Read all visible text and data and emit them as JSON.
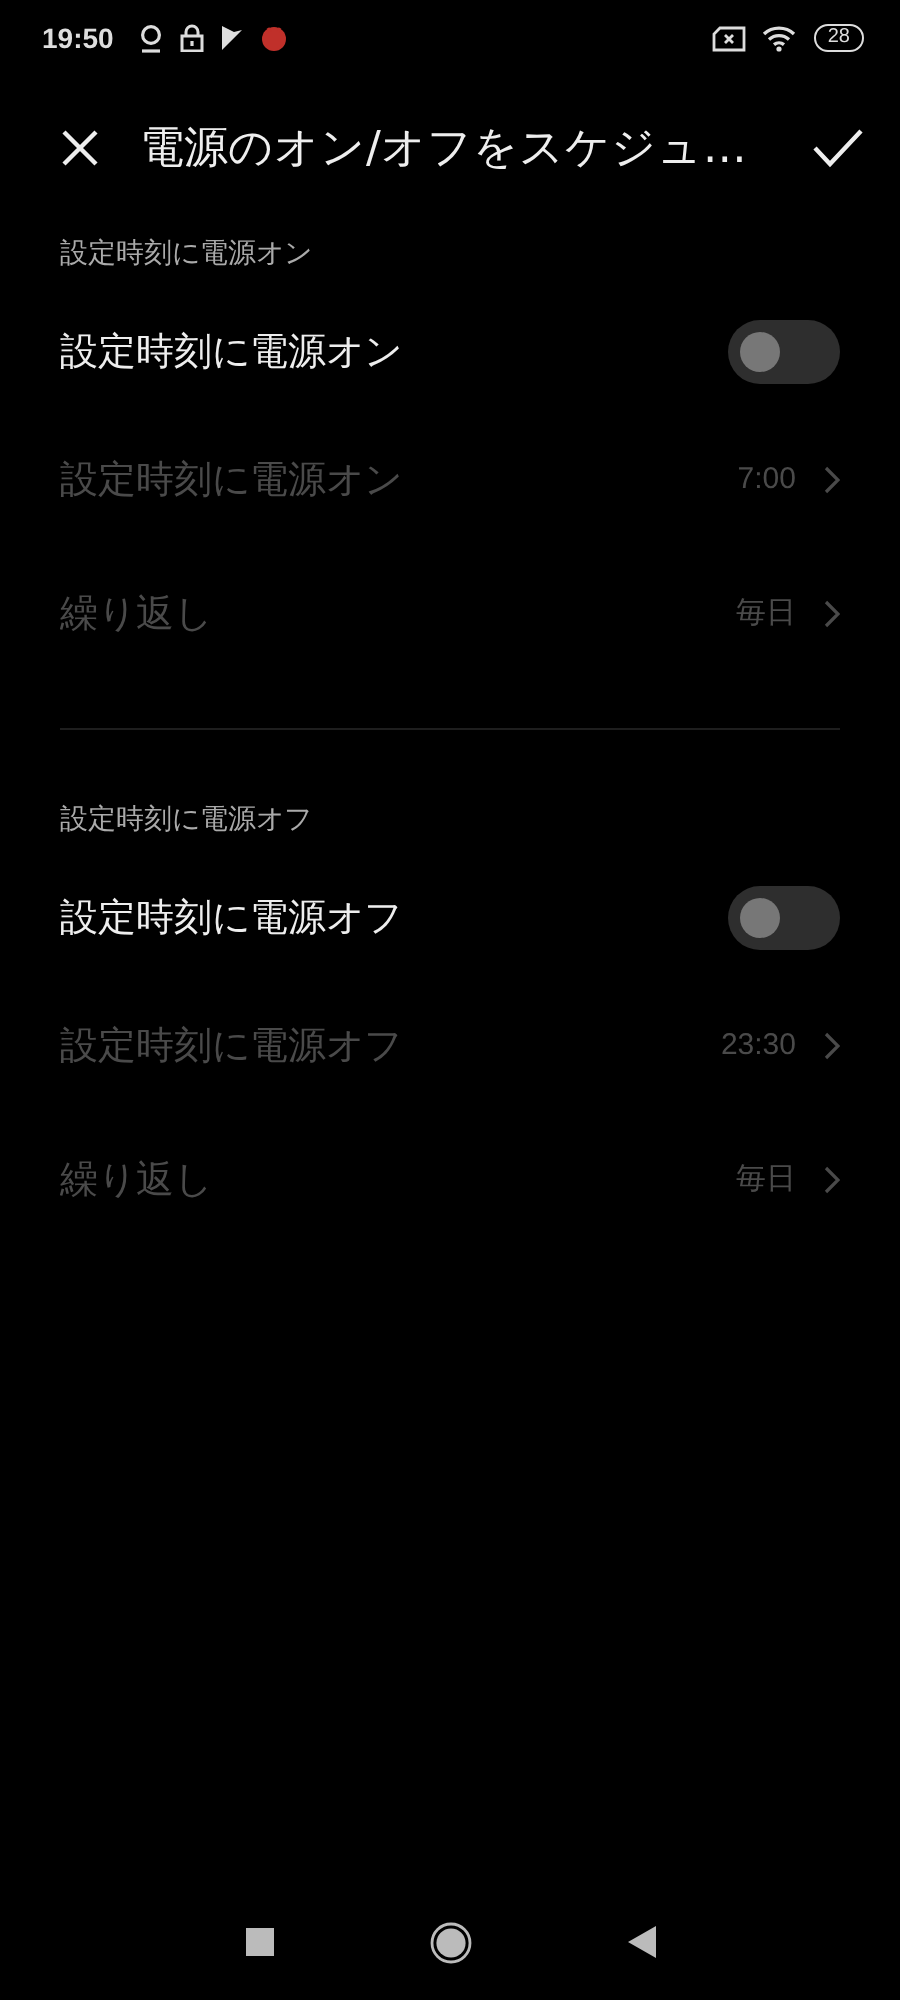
{
  "status_bar": {
    "time": "19:50",
    "battery": "28"
  },
  "header": {
    "title": "電源のオン/オフをスケジュ…"
  },
  "sections": [
    {
      "heading": "設定時刻に電源オン",
      "toggle": {
        "label": "設定時刻に電源オン",
        "on": false
      },
      "rows": [
        {
          "label": "設定時刻に電源オン",
          "value": "7:00",
          "disabled": true
        },
        {
          "label": "繰り返し",
          "value": "毎日",
          "disabled": true
        }
      ]
    },
    {
      "heading": "設定時刻に電源オフ",
      "toggle": {
        "label": "設定時刻に電源オフ",
        "on": false
      },
      "rows": [
        {
          "label": "設定時刻に電源オフ",
          "value": "23:30",
          "disabled": true
        },
        {
          "label": "繰り返し",
          "value": "毎日",
          "disabled": true
        }
      ]
    }
  ]
}
